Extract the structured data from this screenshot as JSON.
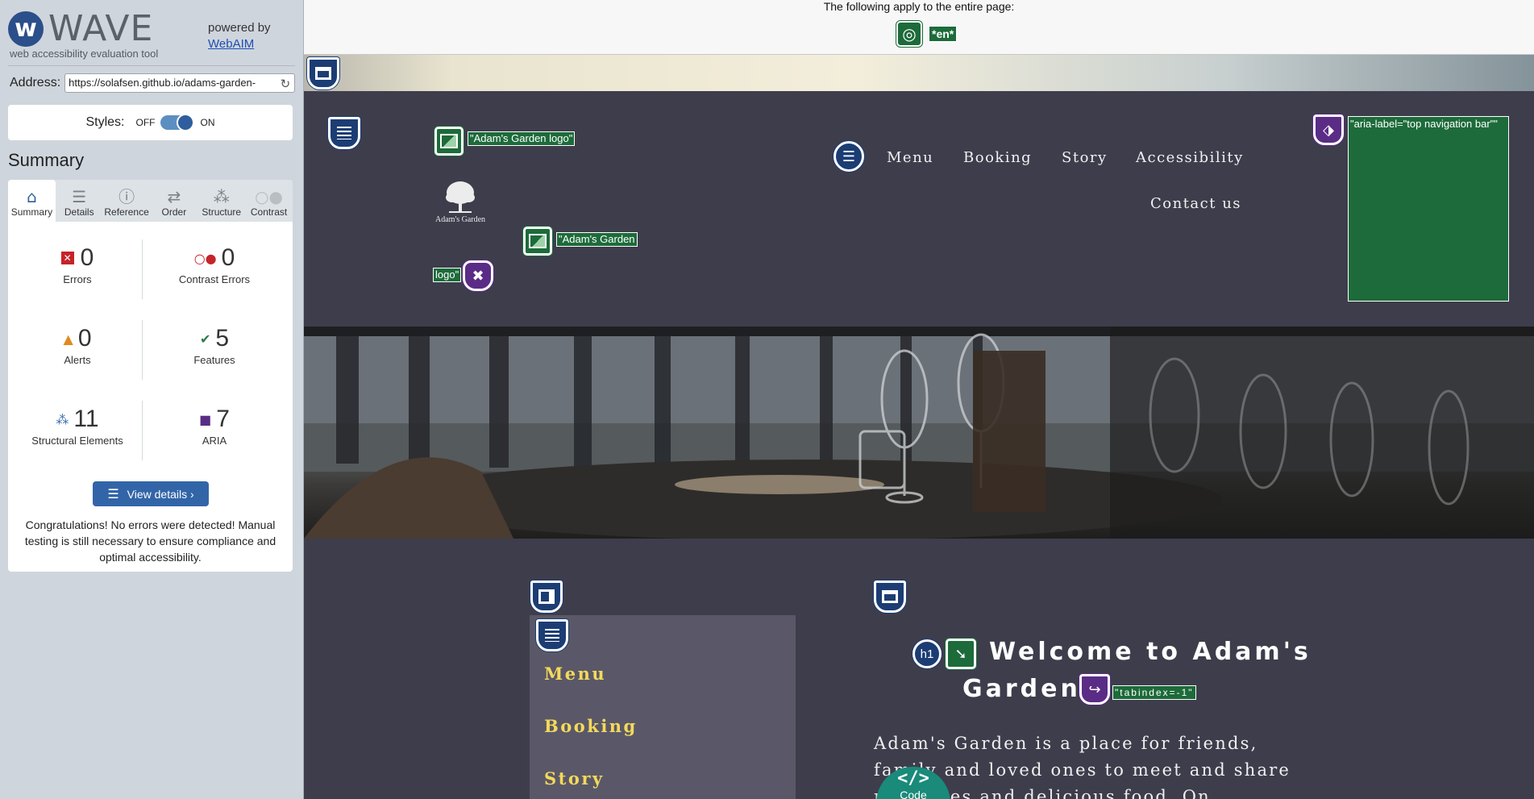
{
  "wave": {
    "logo_word": "WAVE",
    "logo_mark": "w",
    "tagline": "web accessibility evaluation tool",
    "powered_by": "powered by",
    "powered_link": "WebAIM",
    "address_label": "Address:",
    "address_value": "https://solafsen.github.io/adams-garden-",
    "reload_icon": "reload-icon",
    "styles_label": "Styles:",
    "styles_off": "OFF",
    "styles_on": "ON",
    "styles_enabled": true,
    "summary_heading": "Summary",
    "tabs": [
      {
        "label": "Summary",
        "icon": "home-icon",
        "active": true
      },
      {
        "label": "Details",
        "icon": "list-icon",
        "active": false
      },
      {
        "label": "Reference",
        "icon": "info-icon",
        "active": false
      },
      {
        "label": "Order",
        "icon": "order-icon",
        "active": false
      },
      {
        "label": "Structure",
        "icon": "structure-icon",
        "active": false
      },
      {
        "label": "Contrast",
        "icon": "contrast-icon",
        "active": false
      }
    ],
    "stats": {
      "errors": {
        "value": "0",
        "label": "Errors",
        "color": "#c6232a"
      },
      "contrast_errors": {
        "value": "0",
        "label": "Contrast Errors",
        "color": "#c6232a"
      },
      "alerts": {
        "value": "0",
        "label": "Alerts",
        "color": "#e08a1e"
      },
      "features": {
        "value": "5",
        "label": "Features",
        "color": "#2d7a48"
      },
      "structural": {
        "value": "11",
        "label": "Structural Elements",
        "color": "#3a6db0"
      },
      "aria": {
        "value": "7",
        "label": "ARIA",
        "color": "#5a2c86"
      }
    },
    "view_details": "View details ›",
    "congrats": "Congratulations! No errors were detected! Manual testing is still necessary to ensure compliance and optimal accessibility."
  },
  "page": {
    "top_text": "The following apply to the entire page:",
    "lang_tag": "*en*",
    "logo_alt_label_1": "\"Adam's Garden logo\"",
    "logo_alt_label_2a": "\"Adam's Garden",
    "logo_alt_label_2b": "logo\"",
    "logo_text": "Adam's Garden",
    "nav": [
      "Menu",
      "Booking",
      "Story",
      "Accessibility",
      "Contact us"
    ],
    "aria_nav_label": "\"aria-label=\"top navigation bar\"\"",
    "side_menu": [
      "Menu",
      "Booking",
      "Story"
    ],
    "welcome_line1": "Welcome to Adam's",
    "welcome_line2": "Garden",
    "tabindex_label": "\"tabindex=-1\"",
    "intro": "Adam's Garden is a place for friends, family and loved ones to meet and share memories and delicious food. On",
    "code_glyph": "</>",
    "code_label": "Code"
  },
  "colors": {
    "header_bg": "#3e3d4c",
    "side_menu_bg": "#5a5868",
    "side_menu_text": "#f4d95a",
    "wave_green": "#1d6b3a",
    "wave_blue": "#1c3d74",
    "wave_purple": "#5a2c86"
  }
}
